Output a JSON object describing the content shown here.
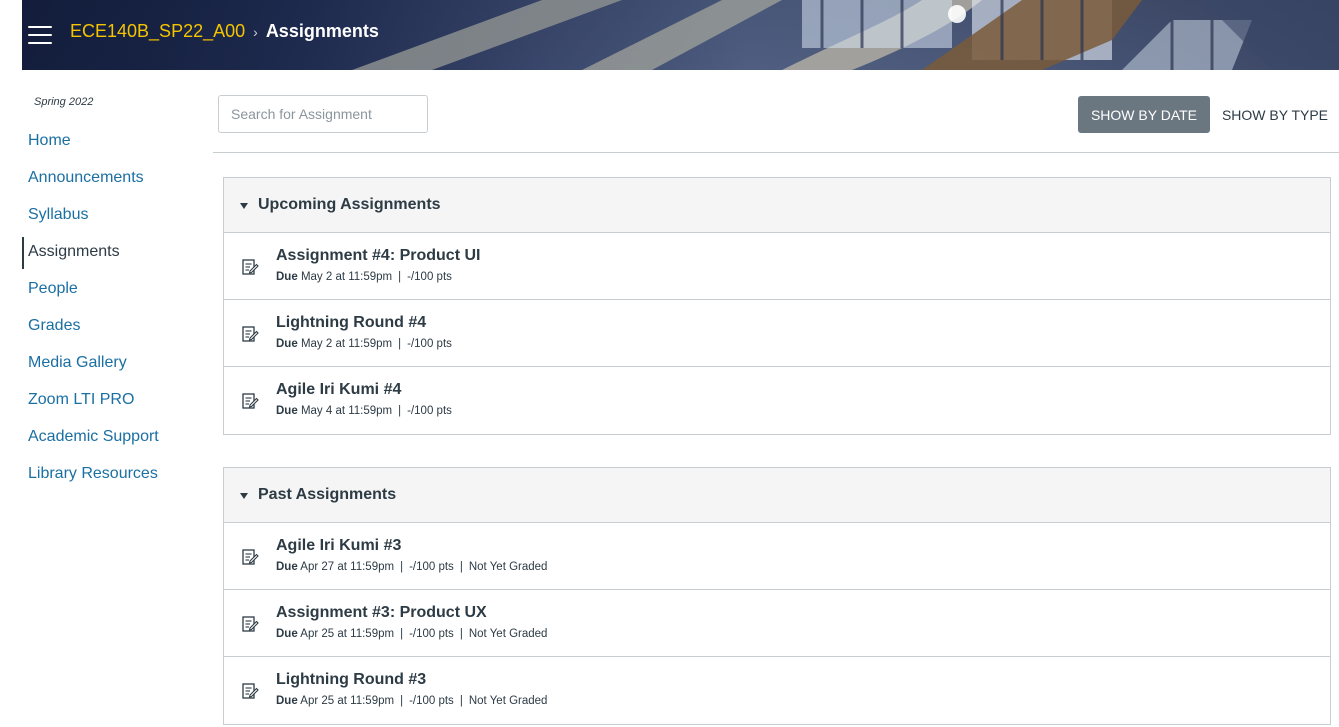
{
  "header": {
    "course": "ECE140B_SP22_A00",
    "separator": "›",
    "page": "Assignments"
  },
  "sidebar": {
    "term": "Spring 2022",
    "items": [
      {
        "label": "Home"
      },
      {
        "label": "Announcements"
      },
      {
        "label": "Syllabus"
      },
      {
        "label": "Assignments",
        "active": true
      },
      {
        "label": "People"
      },
      {
        "label": "Grades"
      },
      {
        "label": "Media Gallery"
      },
      {
        "label": "Zoom LTI PRO"
      },
      {
        "label": "Academic Support"
      },
      {
        "label": "Library Resources"
      }
    ]
  },
  "toolbar": {
    "search_placeholder": "Search for Assignment",
    "show_by_date": "SHOW BY DATE",
    "show_by_type": "SHOW BY TYPE"
  },
  "groups": {
    "upcoming": {
      "title": "Upcoming Assignments",
      "items": [
        {
          "title": "Assignment #4: Product UI",
          "due_label": "Due",
          "due": "May 2 at 11:59pm",
          "points": "-/100 pts"
        },
        {
          "title": "Lightning Round #4",
          "due_label": "Due",
          "due": "May 2 at 11:59pm",
          "points": "-/100 pts"
        },
        {
          "title": "Agile Iri Kumi #4",
          "due_label": "Due",
          "due": "May 4 at 11:59pm",
          "points": "-/100 pts"
        }
      ]
    },
    "past": {
      "title": "Past Assignments",
      "items": [
        {
          "title": "Agile Iri Kumi #3",
          "due_label": "Due",
          "due": "Apr 27 at 11:59pm",
          "points": "-/100 pts",
          "status": "Not Yet Graded"
        },
        {
          "title": "Assignment #3: Product UX",
          "due_label": "Due",
          "due": "Apr 25 at 11:59pm",
          "points": "-/100 pts",
          "status": "Not Yet Graded"
        },
        {
          "title": "Lightning Round #3",
          "due_label": "Due",
          "due": "Apr 25 at 11:59pm",
          "points": "-/100 pts",
          "status": "Not Yet Graded"
        }
      ]
    }
  },
  "icons": {
    "assignment": "assignment-icon",
    "menu": "hamburger-icon",
    "collapse": "caret-down-icon"
  },
  "colors": {
    "link": "#1a6fa3",
    "course_breadcrumb": "#f5c400",
    "primary_button": "#6b7780",
    "text": "#2d3b45"
  }
}
